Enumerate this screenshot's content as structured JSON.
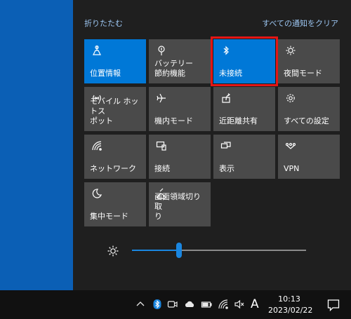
{
  "header": {
    "collapse_label": "折りたたむ",
    "clear_label": "すべての通知をクリア"
  },
  "tiles": [
    {
      "label": "位置情報",
      "icon": "location-icon",
      "active": true
    },
    {
      "label": "バッテリー\n節約機能",
      "icon": "battery-saver-icon",
      "active": false
    },
    {
      "label": "未接続",
      "icon": "bluetooth-icon",
      "active": true
    },
    {
      "label": "夜間モード",
      "icon": "night-light-icon",
      "active": false
    },
    {
      "label": "モバイル ホットス\nポット",
      "icon": "mobile-hotspot-icon",
      "active": false
    },
    {
      "label": "機内モード",
      "icon": "airplane-icon",
      "active": false
    },
    {
      "label": "近距離共有",
      "icon": "nearby-share-icon",
      "active": false
    },
    {
      "label": "すべての設定",
      "icon": "settings-gear-icon",
      "active": false
    },
    {
      "label": "ネットワーク",
      "icon": "network-icon",
      "active": false
    },
    {
      "label": "接続",
      "icon": "connect-icon",
      "active": false
    },
    {
      "label": "表示",
      "icon": "project-icon",
      "active": false
    },
    {
      "label": "VPN",
      "icon": "vpn-icon",
      "active": false
    },
    {
      "label": "集中モード",
      "icon": "focus-assist-icon",
      "active": false
    },
    {
      "label": "画面領域切り取\nり",
      "icon": "snip-icon",
      "active": false
    }
  ],
  "brightness": {
    "value_percent": 27,
    "icon": "brightness-icon"
  },
  "taskbar": {
    "tray_icons": [
      "chevron-up-icon",
      "bluetooth-icon",
      "meet-now-icon",
      "onedrive-cloud-icon",
      "battery-icon",
      "wifi-icon",
      "volume-mute-icon"
    ],
    "ime_label": "A",
    "time": "10:13",
    "date": "2023/02/22",
    "notification_icon": "action-center-icon"
  },
  "colors": {
    "active_tile": "#0078d7",
    "inactive_tile": "#4a4a4a",
    "highlight": "#e31515",
    "link": "#9cc6f2"
  }
}
